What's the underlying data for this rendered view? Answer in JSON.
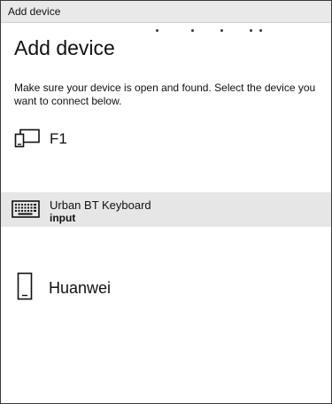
{
  "window": {
    "title": "Add device"
  },
  "page": {
    "heading": "Add device",
    "description": "Make sure your device is open and found. Select the device you want to connect below."
  },
  "devices": [
    {
      "name": "F1",
      "subtitle": "",
      "icon": "tablet-phone-icon"
    },
    {
      "name": "Urban BT Keyboard",
      "subtitle": "input",
      "icon": "keyboard-icon"
    },
    {
      "name": "Huanwei",
      "subtitle": "",
      "icon": "phone-icon"
    }
  ],
  "loading_indicator": {
    "icon": "progress-dots-icon"
  },
  "colors": {
    "titlebar_bg": "#e9e9e9",
    "selected_row_bg": "#e6e6e6",
    "text": "#111111",
    "border": "#3a3a3a"
  }
}
